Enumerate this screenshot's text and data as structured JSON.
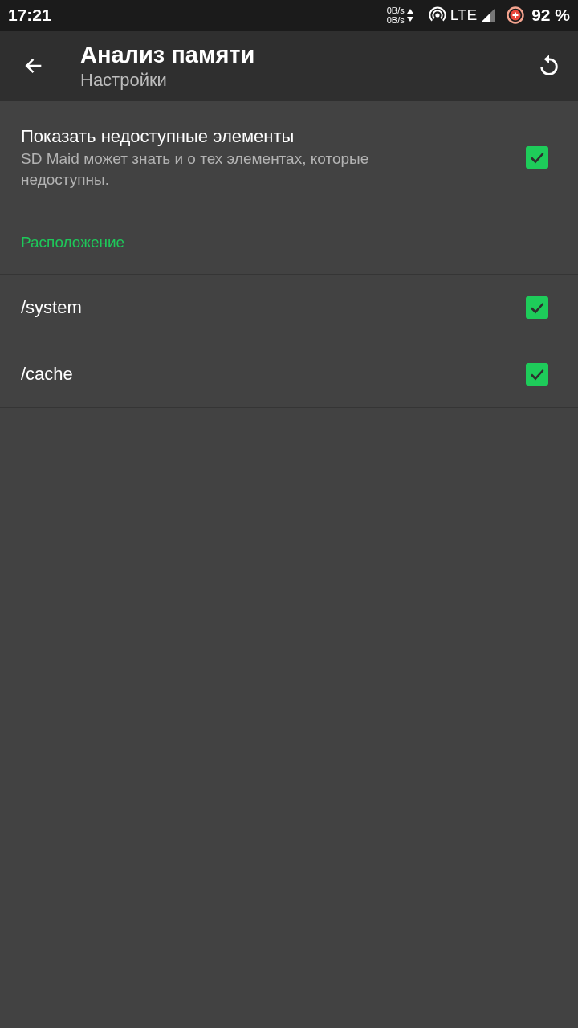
{
  "status_bar": {
    "time": "17:21",
    "net_up": "0B/s",
    "net_down": "0B/s",
    "network": "LTE",
    "battery": "92 %"
  },
  "toolbar": {
    "title": "Анализ памяти",
    "subtitle": "Настройки"
  },
  "settings": [
    {
      "kind": "checkbox",
      "title": "Показать недоступные элементы",
      "summary": "SD Maid может знать и о тех элементах, которые недоступны.",
      "checked": true
    },
    {
      "kind": "category",
      "title": "Расположение"
    },
    {
      "kind": "checkbox",
      "title": "/system",
      "checked": true
    },
    {
      "kind": "checkbox",
      "title": "/cache",
      "checked": true
    }
  ]
}
